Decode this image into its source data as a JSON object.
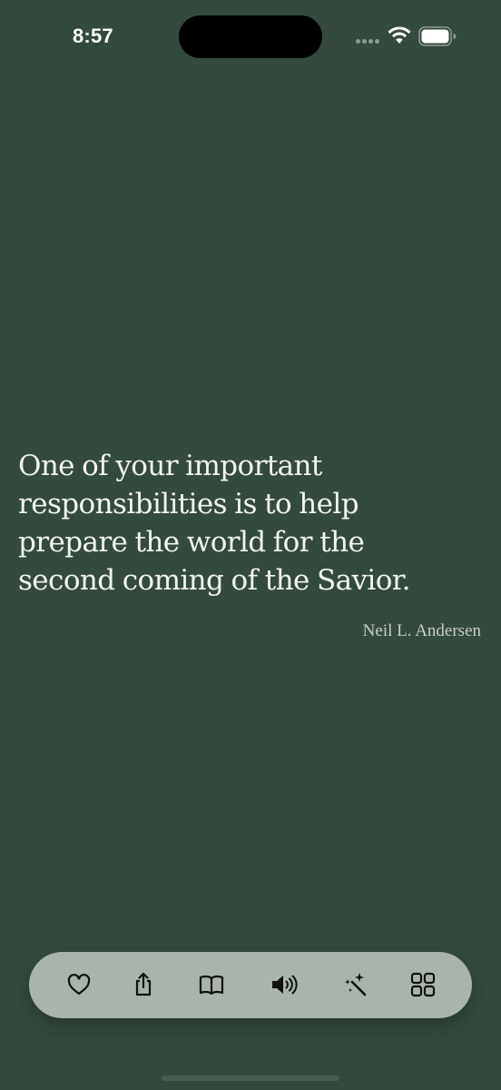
{
  "status_bar": {
    "time": "8:57",
    "wifi_icon": "wifi-icon",
    "battery_icon": "battery-icon"
  },
  "quote": {
    "lines": [
      "One of your important",
      "responsibilities is to help",
      "prepare the world for the",
      "second coming of the Savior."
    ],
    "author": "Neil L. Andersen"
  },
  "toolbar": {
    "buttons": [
      {
        "icon": "heart-icon"
      },
      {
        "icon": "share-icon"
      },
      {
        "icon": "book-icon"
      },
      {
        "icon": "speaker-icon"
      },
      {
        "icon": "magic-wand-icon"
      },
      {
        "icon": "grid-icon"
      }
    ]
  },
  "colors": {
    "background": "#344a3d",
    "text": "#f3f4ef",
    "author": "#c9cec8",
    "toolbar": "#a9b4ab"
  }
}
